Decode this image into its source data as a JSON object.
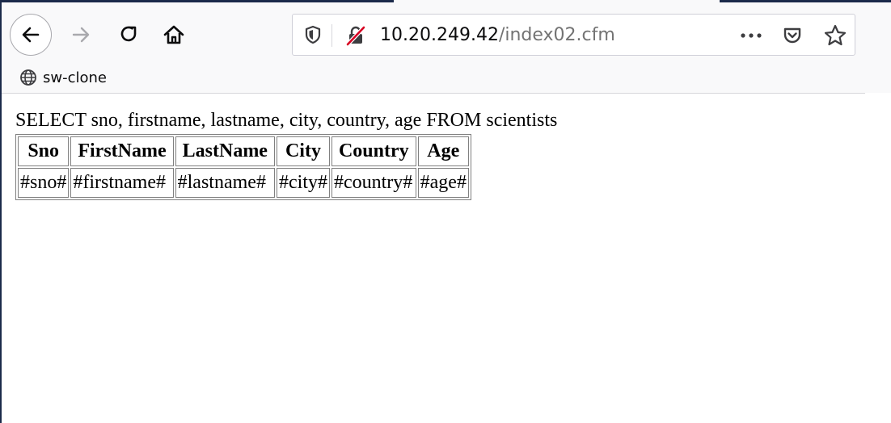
{
  "browser": {
    "url_host": "10.20.249.42",
    "url_path": "/index02.cfm",
    "bookmark_label": "sw-clone",
    "icons": {
      "back": "back-arrow-icon",
      "forward": "forward-arrow-icon",
      "reload": "reload-icon",
      "home": "home-icon",
      "shield": "tracking-protection-shield-icon",
      "insecure": "insecure-connection-lock-icon",
      "more": "page-actions-more-icon",
      "pocket": "pocket-icon",
      "star": "bookmark-star-icon",
      "globe": "globe-icon"
    },
    "colors": {
      "insecure_accent": "#d70022",
      "chrome_bg": "#f9f9fa",
      "frame_dark": "#1b2a4a"
    }
  },
  "page": {
    "query_text": "SELECT sno, firstname, lastname, city, country, age FROM scientists",
    "table": {
      "headers": [
        "Sno",
        "FirstName",
        "LastName",
        "City",
        "Country",
        "Age"
      ],
      "rows": [
        [
          "#sno#",
          "#firstname#",
          "#lastname#",
          "#city#",
          "#country#",
          "#age#"
        ]
      ]
    }
  }
}
